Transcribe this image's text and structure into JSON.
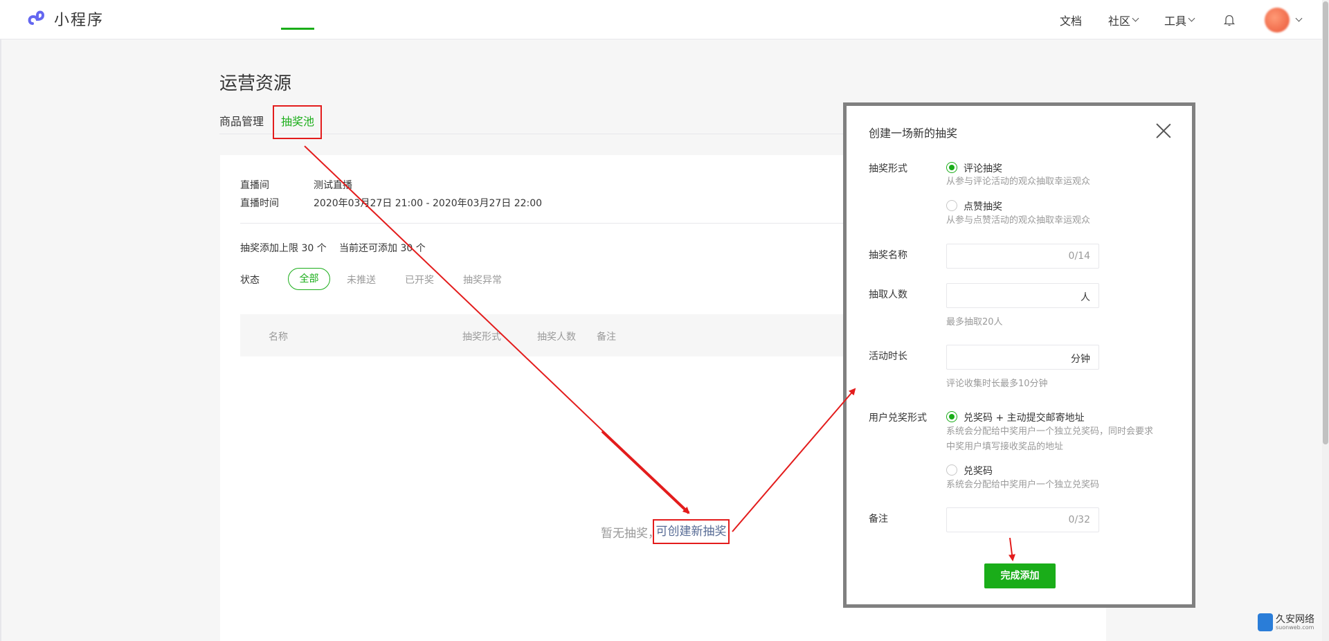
{
  "header": {
    "app_name": "小程序",
    "nav": [
      {
        "label": "文档"
      },
      {
        "label": "社区"
      },
      {
        "label": "工具"
      }
    ]
  },
  "page": {
    "title": "运营资源",
    "tabs": [
      {
        "label": "商品管理",
        "active": false
      },
      {
        "label": "抽奖池",
        "active": true
      }
    ]
  },
  "live": {
    "room_label": "直播间",
    "room_value": "测试直播",
    "time_label": "直播时间",
    "time_value": "2020年03月27日 21:00 - 2020年03月27日 22:00"
  },
  "limits": {
    "max_text": "抽奖添加上限 30 个",
    "remaining_text": "当前还可添加 30 个"
  },
  "status_filter": {
    "label": "状态",
    "options": [
      "全部",
      "未推送",
      "已开奖",
      "抽奖异常"
    ],
    "selected": "全部"
  },
  "table": {
    "columns": [
      "名称",
      "抽奖形式",
      "抽奖人数",
      "备注"
    ]
  },
  "empty_state": {
    "text": "暂无抽奖，",
    "link": "可创建新抽奖"
  },
  "modal": {
    "title": "创建一场新的抽奖",
    "form": {
      "type_label": "抽奖形式",
      "type_options": [
        {
          "label": "评论抽奖",
          "hint": "从参与评论活动的观众抽取幸运观众",
          "checked": true
        },
        {
          "label": "点赞抽奖",
          "hint": "从参与点赞活动的观众抽取幸运观众",
          "checked": false
        }
      ],
      "name_label": "抽奖名称",
      "name_counter": "0/14",
      "count_label": "抽取人数",
      "count_suffix": "人",
      "count_hint": "最多抽取20人",
      "duration_label": "活动时长",
      "duration_suffix": "分钟",
      "duration_hint": "评论收集时长最多10分钟",
      "redeem_label": "用户兑奖形式",
      "redeem_options": [
        {
          "label": "兑奖码 + 主动提交邮寄地址",
          "hint_line1": "系统会分配给中奖用户一个独立兑奖码，同时会要求",
          "hint_line2": "中奖用户填写接收奖品的地址",
          "checked": true
        },
        {
          "label": "兑奖码",
          "hint_line1": "系统会分配给中奖用户一个独立兑奖码",
          "checked": false
        }
      ],
      "note_label": "备注",
      "note_counter": "0/32"
    },
    "submit_label": "完成添加"
  },
  "watermark": {
    "text": "久安网络",
    "sub": "suonweb.com"
  },
  "colors": {
    "accent": "#1aad19",
    "link": "#576b95",
    "annotation": "#e31c1c"
  }
}
